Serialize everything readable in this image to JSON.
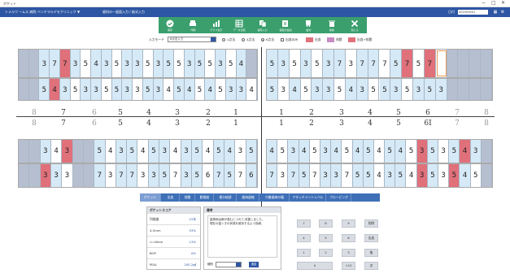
{
  "window": {
    "title": "ポケット",
    "controls": [
      "−",
      "□",
      "✕"
    ]
  },
  "infobar": {
    "left": "トメルワ ームス 病院 ベンチマルデモクリニック ▼",
    "crumb": "歯科の一画面入力 / 歯式入力",
    "date_label": "日付",
    "date": "2019/09/01"
  },
  "toolbar": [
    {
      "icon": "check-icon",
      "label": "保存"
    },
    {
      "icon": "print-icon",
      "label": "印刷"
    },
    {
      "icon": "chart-icon",
      "label": "グラフ表示"
    },
    {
      "icon": "grid-icon",
      "label": "データ比較"
    },
    {
      "icon": "copy-icon",
      "label": "複写入力"
    },
    {
      "icon": "edit-icon",
      "label": "検査の追加"
    },
    {
      "icon": "tooth-icon",
      "label": "歯式"
    },
    {
      "icon": "trash-icon",
      "label": "削除"
    },
    {
      "icon": "close-icon",
      "label": "閉じる"
    }
  ],
  "controls": {
    "input_mode_label": "入力モード",
    "input_mode_value": "6点法入力",
    "radios": [
      "1点法",
      "4点法",
      "6点法"
    ],
    "checks": [
      "出血のみ"
    ],
    "legend": [
      {
        "label": "出血",
        "color": "#e0707a"
      },
      {
        "label": "排膿",
        "color": "#c98bc3"
      },
      {
        "label": "出血+排膿",
        "color": "#e0707a"
      }
    ]
  },
  "chart_upper": {
    "outer_left": [
      "g",
      "g",
      "3:b",
      "7:b",
      "7:r",
      "3:b",
      "5:w",
      "4:b",
      "3:b",
      "5:w",
      "3:b",
      "3:b",
      "5:w",
      "3:b",
      "5:b",
      "5:w",
      "3:b",
      "5:b",
      "5:w",
      "3:b",
      "5:w",
      "4:b",
      "g"
    ],
    "outer_right": [
      "5:b",
      "3:b",
      "5:w",
      "3:b",
      "5:w",
      "3:b",
      "7:b",
      "3:w",
      "7:b",
      "7:b",
      "7:w",
      "5:b",
      "7:r",
      "5:w",
      "7:r",
      "o",
      "g",
      "g",
      "g",
      "g"
    ],
    "inner_left": [
      "g",
      "g",
      "5:b",
      "4:r",
      "3:b",
      "5:w",
      "3:b",
      "3:b",
      "5:w",
      "5:b",
      "3:b",
      "3:w",
      "5:b",
      "3:b",
      "4:w",
      "5:b",
      "4:b",
      "5:w",
      "4:b",
      "5:w",
      "3:b",
      "3:b",
      "4:w"
    ],
    "inner_right": [
      "5:b",
      "3:w",
      "4:b",
      "5:w",
      "3:b",
      "3:b",
      "5:w",
      "4:b",
      "3:b",
      "5:w",
      "5:b",
      "3:b",
      "5:w",
      "3:b",
      "5:b",
      "3:b",
      "g",
      "g",
      "g",
      "g"
    ]
  },
  "chart_lower": {
    "outer_left": [
      "g",
      "g",
      "3:b",
      "4:w",
      "3:r",
      "g",
      "g",
      "5:b",
      "4:w",
      "3:b",
      "5:b",
      "4:w",
      "5:b",
      "3:b",
      "4:w",
      "3:b",
      "5:b",
      "4:w",
      "5:b",
      "4:b",
      "3:w",
      "5:b"
    ],
    "outer_right": [
      "4:b",
      "5:w",
      "3:b",
      "4:b",
      "5:w",
      "3:b",
      "4:b",
      "5:w",
      "4:b",
      "5:b",
      "4:w",
      "5:b",
      "4:b",
      "5:w",
      "3:r",
      "5:b",
      "3:w",
      "5:b",
      "4:r",
      "3:b",
      "g"
    ],
    "inner_left": [
      "g",
      "g",
      "3:r",
      "3:b",
      "3:w",
      "g",
      "g",
      "7:b",
      "3:w",
      "7:b",
      "7:b",
      "3:w",
      "3:b",
      "5:b",
      "7:w",
      "3:b",
      "5:b",
      "6:w",
      "7:b",
      "5:b",
      "7:w",
      "6:b"
    ],
    "inner_right": [
      "7:b",
      "3:w",
      "7:b",
      "5:b",
      "7:w",
      "3:b",
      "3:b",
      "7:w",
      "5:b",
      "5:b",
      "4:w",
      "3:b",
      "5:b",
      "4:w",
      "3:r",
      "5:b",
      "3:w",
      "5:r",
      "4:b",
      "5:w",
      "g"
    ]
  },
  "tooth_numbers": {
    "left": [
      "8",
      "7",
      "6",
      "5",
      "4",
      "3",
      "2",
      "1"
    ],
    "right": [
      "1",
      "2",
      "3",
      "4",
      "5",
      "6",
      "7",
      "8"
    ],
    "right_lower_6": "6I"
  },
  "tabs": [
    "ポケット",
    "出血",
    "排膿",
    "動揺度",
    "根分岐部",
    "歯肉退縮",
    "付着歯肉の幅",
    "アタッチメントレベル",
    "プロービング"
  ],
  "pocket_score": {
    "title": "ポケットスコア",
    "rows": [
      {
        "label": "列検査",
        "value": "23本"
      },
      {
        "label": "4-5mm",
        "value": "53%"
      },
      {
        "label": ">=6mm",
        "value": "13%"
      },
      {
        "label": "BOP",
        "value": "0%"
      },
      {
        "label": "PISA",
        "value": "205.2㎟"
      }
    ]
  },
  "memo": {
    "title": "備考",
    "text": "歯周病治療が進むにつれて,改善しました。\n現在の歯ぐきの状態を維持するよう指導。",
    "sort_label": "種別",
    "add_label": "追加"
  },
  "keypad": [
    [
      "7",
      "8",
      "9",
      "削除"
    ],
    [
      "4",
      "5",
      "6",
      "出血"
    ],
    [
      "1",
      "2",
      "3",
      "後"
    ],
    [
      "0",
      "",
      "+10",
      "次"
    ]
  ]
}
